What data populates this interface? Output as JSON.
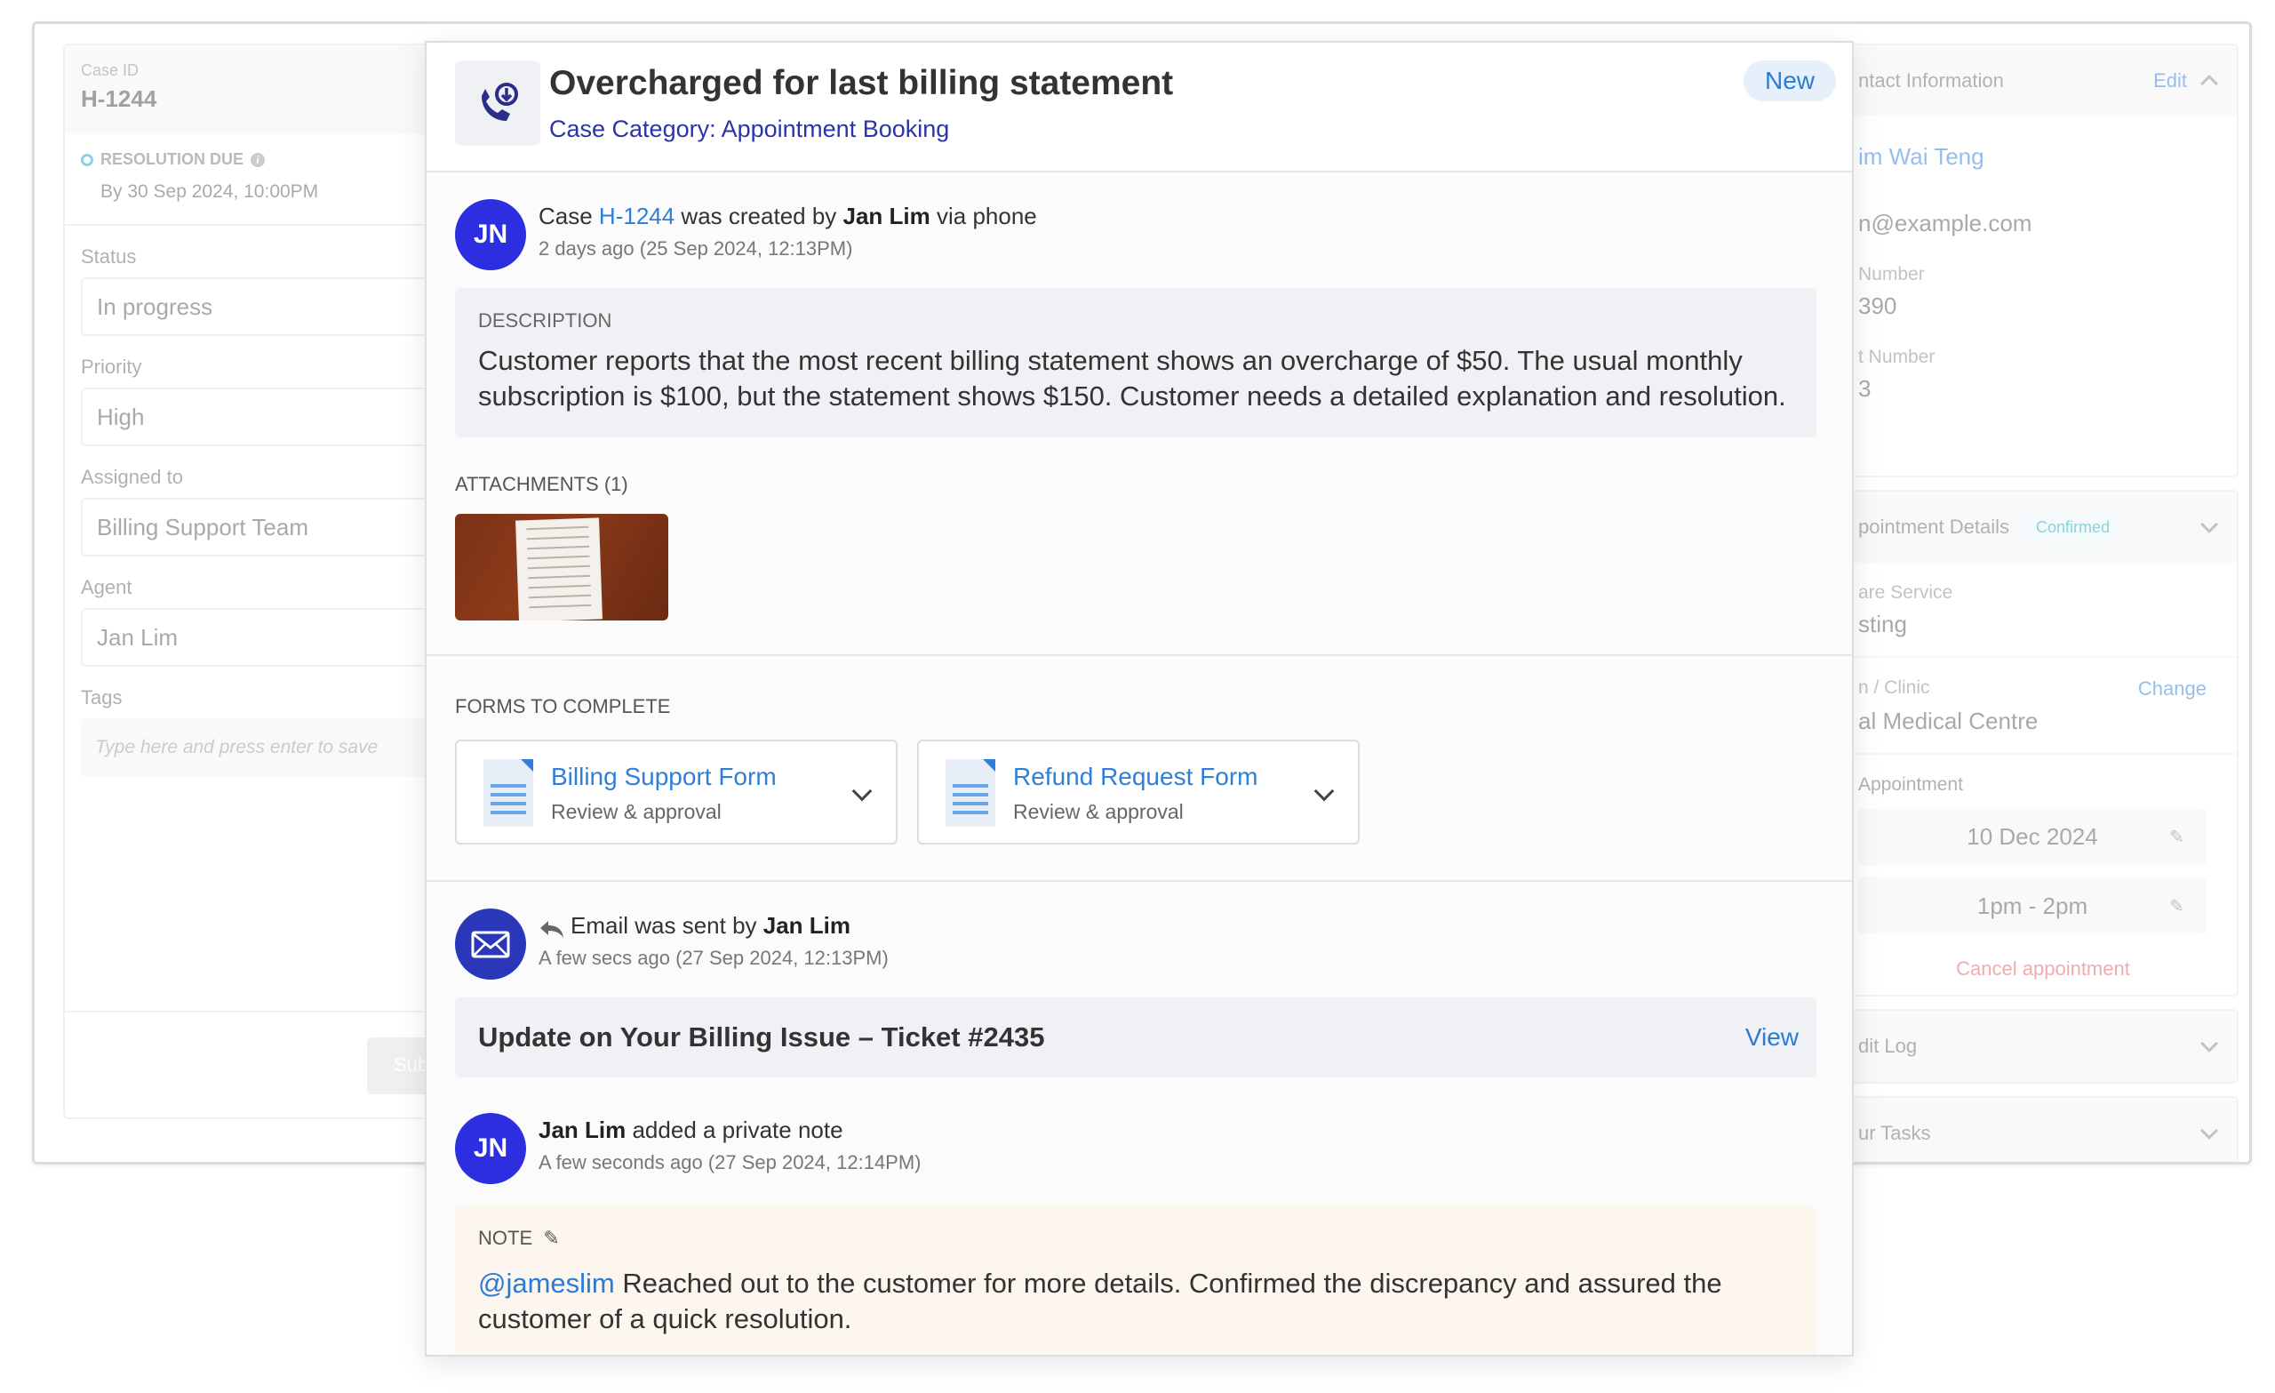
{
  "background": {
    "left_panel": {
      "case_id_label": "Case ID",
      "case_id": "H-1244",
      "resolution_due_label": "RESOLUTION DUE",
      "resolution_due_value": "By 30 Sep 2024, 10:00PM",
      "fields": [
        {
          "label": "Status",
          "value": "In progress"
        },
        {
          "label": "Priority",
          "value": "High"
        },
        {
          "label": "Assigned to",
          "value": "Billing Support Team"
        },
        {
          "label": "Agent",
          "value": "Jan Lim"
        }
      ],
      "tags_label": "Tags",
      "tags_placeholder": "Type here and press enter to save",
      "submit_label": "Sub"
    },
    "right_panel": {
      "contact_header": "ntact Information",
      "contact_edit": "Edit",
      "contact_name": "im Wai Teng",
      "contact_email": "n@example.com",
      "number_label": "Number",
      "number_value": "390",
      "account_label": "t Number",
      "account_value": "3",
      "appt_header": "pointment Details",
      "appt_status": "Confirmed",
      "service_label": "are Service",
      "service_value": "sting",
      "clinic_label": "n / Clinic",
      "clinic_change": "Change",
      "clinic_value": "al Medical Centre",
      "appt_label": "Appointment",
      "appt_date": "10 Dec 2024",
      "appt_time": "1pm - 2pm",
      "cancel_label": "Cancel appointment",
      "edit_log": "dit Log",
      "tasks": "ur Tasks"
    }
  },
  "modal": {
    "title": "Overcharged for last billing statement",
    "category": "Case Category: Appointment Booking",
    "status_badge": "New",
    "created_event": {
      "avatar": "JN",
      "prefix": "Case ",
      "case_link": "H-1244",
      "mid": " was created by ",
      "agent": "Jan Lim",
      "suffix": " via phone",
      "time": "2 days ago (25 Sep 2024, 12:13PM)"
    },
    "description": {
      "label": "DESCRIPTION",
      "text": "Customer reports that the most recent billing statement shows an overcharge of $50. The usual monthly subscription is $100, but the statement shows $150. Customer needs a detailed explanation and resolution."
    },
    "attachments_label": "ATTACHMENTS (1)",
    "forms_label": "FORMS TO COMPLETE",
    "forms": [
      {
        "title": "Billing Support Form",
        "subtitle": "Review & approval"
      },
      {
        "title": "Refund Request Form",
        "subtitle": "Review & approval"
      }
    ],
    "email_event": {
      "prefix": "Email was sent by ",
      "agent": "Jan Lim",
      "time": "A few secs ago (27 Sep 2024, 12:13PM)",
      "subject": "Update on Your Billing Issue – Ticket #2435",
      "view_label": "View"
    },
    "note_event": {
      "avatar": "JN",
      "agent": "Jan Lim",
      "action": " added a private note",
      "time": "A few seconds ago (27 Sep 2024, 12:14PM)",
      "label": "NOTE",
      "mention": "@jameslim",
      "text": " Reached out to the customer for more details. Confirmed the discrepancy and assured the customer of a quick resolution."
    }
  },
  "colors": {
    "accent": "#2b7bd6",
    "category": "#2a34a8",
    "avatar": "#2d2ee0",
    "note_bg": "#fdf6ee",
    "cancel": "#e35b5b",
    "confirmed": "#19a9b8"
  },
  "icons": [
    "phone-incoming-icon",
    "info-icon",
    "document-icon",
    "chevron-down-icon",
    "chevron-up-icon",
    "mail-icon",
    "reply-icon",
    "pencil-icon"
  ]
}
